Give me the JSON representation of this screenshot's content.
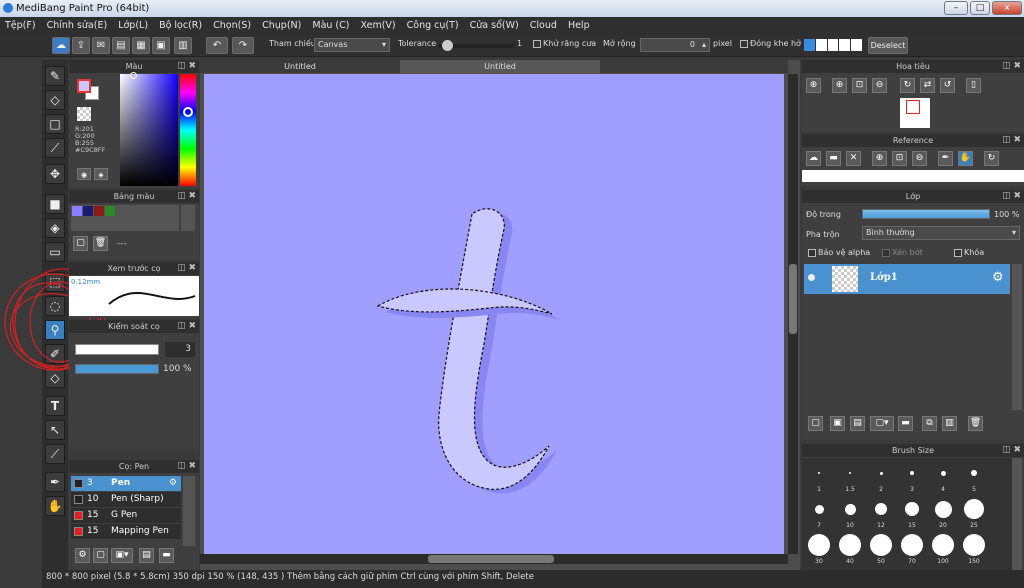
{
  "window": {
    "title": "MediBang Paint Pro (64bit)",
    "min": "–",
    "max": "□",
    "close": "x"
  },
  "menu": [
    "Tệp(F)",
    "Chỉnh sửa(E)",
    "Lớp(L)",
    "Bộ lọc(R)",
    "Chọn(S)",
    "Chụp(N)",
    "Màu (C)",
    "Xem(V)",
    "Công cụ(T)",
    "Cửa sổ(W)",
    "Cloud",
    "Help"
  ],
  "toolbar": {
    "reference_label": "Tham chiếu",
    "reference_value": "Canvas",
    "tolerance_label": "Tolerance",
    "tolerance_value": "1",
    "antialias_label": "Khử răng cưa",
    "expand_label": "Mở rộng",
    "expand_value": "0",
    "expand_unit": "pixel",
    "close_gap_label": "Đóng khe hở",
    "deselect_label": "Deselect",
    "tolerance_fraction": 0.05
  },
  "color_panel": {
    "title": "Màu",
    "r": "R:201",
    "g": "G:200",
    "b": "B:255",
    "hex": "#C9C8FF",
    "foreground": "#c9c8ff",
    "background": "#ffffff"
  },
  "palette_panel": {
    "title": "Bảng màu",
    "swatches": [
      "#8a7dff",
      "#1a1a6e",
      "#8b1a1a",
      "#2a8a2a"
    ],
    "more_label": "---"
  },
  "brush_preview_panel": {
    "title": "Xem trước cọ",
    "size_label": "0.12mm"
  },
  "brush_control_panel": {
    "title": "Kiểm soát cọ",
    "size_value": "3",
    "opacity_value": "100 %",
    "opacity_fraction": 1.0
  },
  "brush_list_panel": {
    "title": "Cọ: Pen",
    "items": [
      {
        "size": "3",
        "name": "Pen",
        "color": "#222",
        "selected": true
      },
      {
        "size": "10",
        "name": "Pen (Sharp)",
        "color": "#222",
        "selected": false
      },
      {
        "size": "15",
        "name": "G Pen",
        "color": "#e02020",
        "selected": false
      },
      {
        "size": "15",
        "name": "Mapping Pen",
        "color": "#e02020",
        "selected": false
      }
    ]
  },
  "document_tabs": [
    "Untitled",
    "Untitled"
  ],
  "canvas": {
    "bg": "#a09eff",
    "letter_fill": "#c9c8ff"
  },
  "navigator_panel": {
    "title": "Hoa tiêu"
  },
  "reference_panel": {
    "title": "Reference"
  },
  "layer_panel": {
    "title": "Lớp",
    "opacity_label": "Độ trong",
    "opacity_value": "100 %",
    "opacity_fraction": 1.0,
    "blend_label": "Pha trộn",
    "blend_value": "Bình thường",
    "protect_alpha_label": "Bảo vệ alpha",
    "clipping_label": "Xén bớt",
    "lock_label": "Khóa",
    "layers": [
      {
        "name": "Lớp1"
      }
    ]
  },
  "brush_size_panel": {
    "title": "Brush Size",
    "row1": [
      "1",
      "1.5",
      "2",
      "3",
      "4",
      "5"
    ],
    "row2": [
      "7",
      "10",
      "12",
      "15",
      "20",
      "25"
    ],
    "row3": [
      "30",
      "40",
      "50",
      "70",
      "100",
      "150"
    ]
  },
  "status": {
    "size": "800 * 800 pixel",
    "physical": "(5.8 * 5.8cm)",
    "dpi": "350 dpi",
    "zoom": "150 %",
    "coords": "(148, 435 )",
    "hint": "Thêm bằng cách giữ phím Ctrl cùng với phím Shift, Delete"
  }
}
